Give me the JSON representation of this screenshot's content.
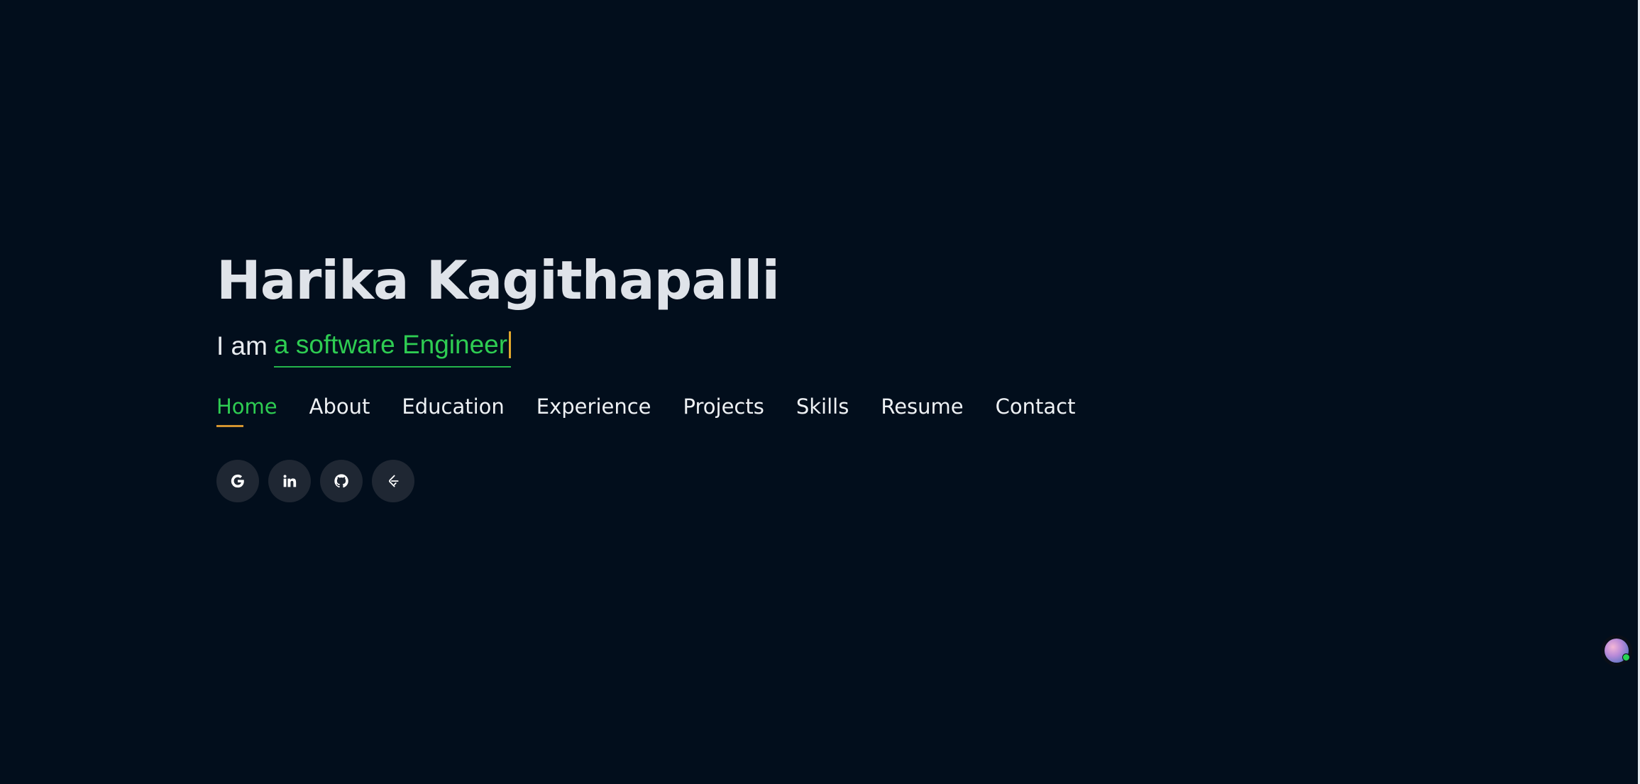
{
  "hero": {
    "name": "Harika Kagithapalli",
    "tagline_prefix": "I am",
    "tagline_typed": "a software Engineer"
  },
  "nav": {
    "items": [
      {
        "label": "Home",
        "active": true
      },
      {
        "label": "About"
      },
      {
        "label": "Education"
      },
      {
        "label": "Experience"
      },
      {
        "label": "Projects"
      },
      {
        "label": "Skills"
      },
      {
        "label": "Resume"
      },
      {
        "label": "Contact"
      }
    ]
  },
  "socials": [
    {
      "icon": "google-icon"
    },
    {
      "icon": "linkedin-icon"
    },
    {
      "icon": "github-icon"
    },
    {
      "icon": "leetcode-icon"
    }
  ],
  "colors": {
    "background": "#020e1c",
    "accent_green": "#2ecc52",
    "accent_gold": "#d39430",
    "text": "#eef1f4",
    "social_bg": "#1f2733"
  }
}
